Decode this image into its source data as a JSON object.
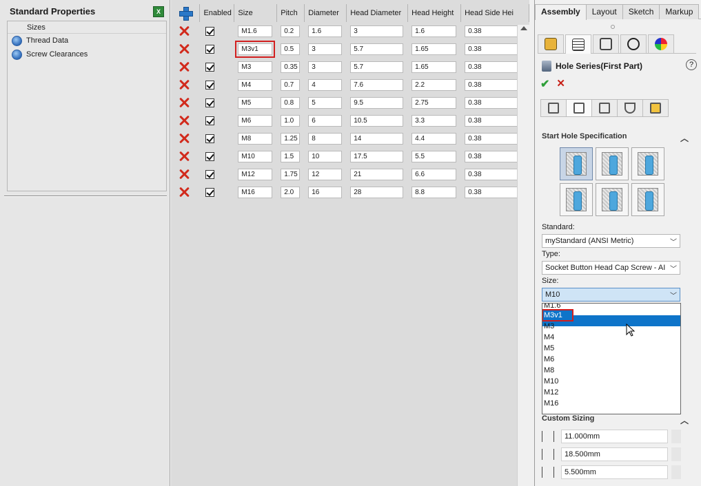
{
  "left": {
    "title": "Standard Properties",
    "excel_icon": "excel-export-icon",
    "tree_header": "Sizes",
    "items": [
      "Thread Data",
      "Screw Clearances"
    ]
  },
  "table": {
    "columns": [
      "Enabled",
      "Size",
      "Pitch",
      "Diameter",
      "Head Diameter",
      "Head Height",
      "Head Side Hei"
    ],
    "rows": [
      {
        "size": "M1.6",
        "pitch": "0.2",
        "diameter": "1.6",
        "head_diameter": "3",
        "head_height": "1.6",
        "head_side": "0.38"
      },
      {
        "size": "M3v1",
        "pitch": "0.5",
        "diameter": "3",
        "head_diameter": "5.7",
        "head_height": "1.65",
        "head_side": "0.38"
      },
      {
        "size": "M3",
        "pitch": "0.35",
        "diameter": "3",
        "head_diameter": "5.7",
        "head_height": "1.65",
        "head_side": "0.38"
      },
      {
        "size": "M4",
        "pitch": "0.7",
        "diameter": "4",
        "head_diameter": "7.6",
        "head_height": "2.2",
        "head_side": "0.38"
      },
      {
        "size": "M5",
        "pitch": "0.8",
        "diameter": "5",
        "head_diameter": "9.5",
        "head_height": "2.75",
        "head_side": "0.38"
      },
      {
        "size": "M6",
        "pitch": "1.0",
        "diameter": "6",
        "head_diameter": "10.5",
        "head_height": "3.3",
        "head_side": "0.38"
      },
      {
        "size": "M8",
        "pitch": "1.25",
        "diameter": "8",
        "head_diameter": "14",
        "head_height": "4.4",
        "head_side": "0.38"
      },
      {
        "size": "M10",
        "pitch": "1.5",
        "diameter": "10",
        "head_diameter": "17.5",
        "head_height": "5.5",
        "head_side": "0.38"
      },
      {
        "size": "M12",
        "pitch": "1.75",
        "diameter": "12",
        "head_diameter": "21",
        "head_height": "6.6",
        "head_side": "0.38"
      },
      {
        "size": "M16",
        "pitch": "2.0",
        "diameter": "16",
        "head_diameter": "28",
        "head_height": "8.8",
        "head_side": "0.38"
      }
    ]
  },
  "right": {
    "tabs": [
      "Assembly",
      "Layout",
      "Sketch",
      "Markup"
    ],
    "pm_title": "Hole Series(First Part)",
    "help": "?",
    "ok": "✔",
    "cancel": "✕",
    "section_start": "Start Hole Specification",
    "standard_label": "Standard:",
    "standard_value": "myStandard (ANSI Metric)",
    "type_label": "Type:",
    "type_value": "Socket Button Head Cap Screw - AI",
    "size_label": "Size:",
    "size_value": "M10",
    "size_options": [
      "M1.6",
      "M3v1",
      "M3",
      "M4",
      "M5",
      "M6",
      "M8",
      "M10",
      "M12",
      "M16"
    ],
    "custom_sizing_label": "Custom Sizing",
    "dims": [
      "11.000mm",
      "18.500mm",
      "5.500mm"
    ]
  }
}
